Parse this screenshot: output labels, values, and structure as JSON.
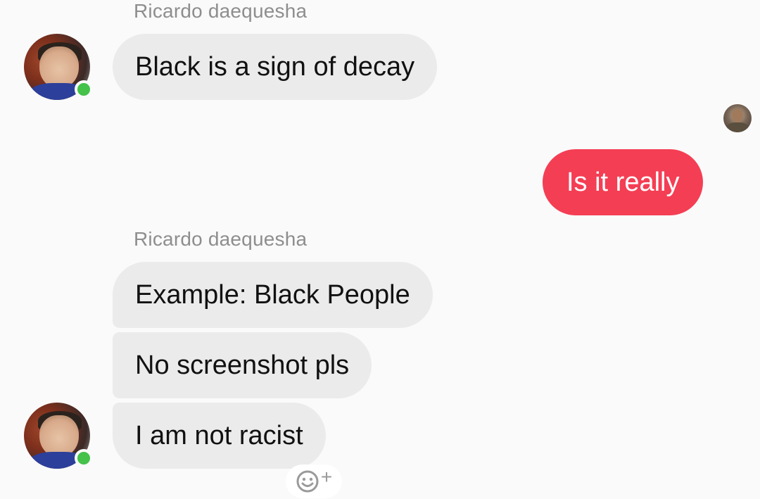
{
  "messages": {
    "group1": {
      "sender": "Ricardo daequesha",
      "items": [
        "Black is a sign of decay"
      ]
    },
    "outgoing": {
      "text": "Is it really"
    },
    "group2": {
      "sender": "Ricardo daequesha",
      "items": [
        "Example: Black People",
        "No screenshot pls",
        "I am not racist"
      ]
    }
  },
  "icons": {
    "online_status": "online-dot",
    "reaction": "smiley-add-icon"
  },
  "colors": {
    "outgoing_bubble": "#f43e54",
    "incoming_bubble": "#ebebeb",
    "online": "#44c24a",
    "sender_name": "#8e8e8e"
  },
  "reaction_plus": "+"
}
